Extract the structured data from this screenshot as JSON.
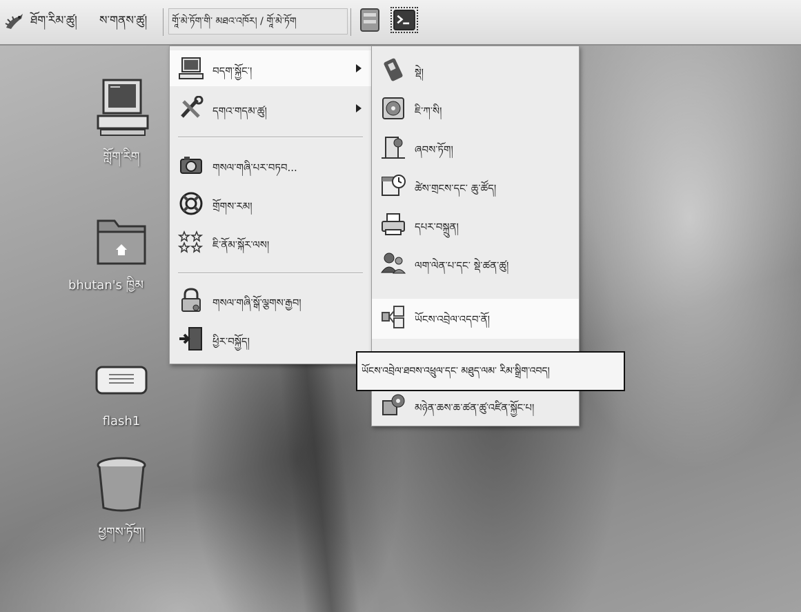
{
  "panel": {
    "applications": "ཐོག་རིམ་ཚུ།",
    "places": "ས་གནས་ཚུ།",
    "system": "གཱོ་མེ་ཏོག་གི་ མཐའ་འཁོར། / གཱོ་མེ་ཏོག"
  },
  "desktop": {
    "computer_label": "གློག་རིག",
    "home_label": "bhutan's ཁྱིམ",
    "flash_label": "flash1",
    "trash_label": "ཕྱགས་ཏོག།"
  },
  "system_menu": {
    "items": [
      {
        "label": "བདག་སྐྱོང་།"
      },
      {
        "label": "དགའ་གདམ་ཚུ།"
      },
      {
        "label": "གསལ་གཞི་པར་བཏབ..."
      },
      {
        "label": "གྲོགས་རམ།"
      },
      {
        "label": "ཇི་ནོམ་སྐོར་ལས།"
      },
      {
        "label": "གསལ་གཞི་སྒོ་ལྕགས་རྒྱབ།"
      },
      {
        "label": "ཕྱིར་བསྐྱོད།"
      }
    ]
  },
  "admin_submenu": {
    "items": [
      {
        "label": "སྡེ།"
      },
      {
        "label": "ཇི་ཀ་སི།"
      },
      {
        "label": "ཞབས་ཏོག།"
      },
      {
        "label": "ཚེས་གྲངས་དང་ ཆུ་ཚོད།"
      },
      {
        "label": "དཔར་བསྐྲུན།"
      },
      {
        "label": "ལག་ལེན་པ་དང་ སྡེ་ཚན་ཚུ།"
      },
      {
        "label": "ཡོངས་འབྲེལ་འདབ་ནོ།"
      },
      {
        "label": "མཉེན་ཆས་ཆ་ཚན་ཚུ་འཛིན་སྐྱོང་པ།"
      }
    ]
  },
  "tooltip": "ཡོངས་འབྲེལ་ཐབས་འཕྲུལ་དང་ མཐུད་ལམ་ རིམ་སྒྲིག་འབད།"
}
